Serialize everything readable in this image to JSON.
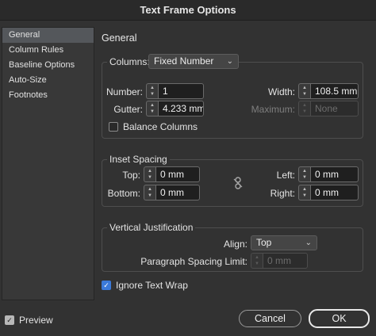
{
  "window": {
    "title": "Text Frame Options"
  },
  "sidebar": {
    "items": [
      {
        "label": "General",
        "active": true
      },
      {
        "label": "Column Rules"
      },
      {
        "label": "Baseline Options"
      },
      {
        "label": "Auto-Size"
      },
      {
        "label": "Footnotes"
      }
    ]
  },
  "general": {
    "heading": "General",
    "columns": {
      "label": "Columns:",
      "type_selected": "Fixed Number",
      "number_label": "Number:",
      "number_value": "1",
      "gutter_label": "Gutter:",
      "gutter_value": "4.233 mm",
      "width_label": "Width:",
      "width_value": "108.5 mm",
      "maximum_label": "Maximum:",
      "maximum_value": "None",
      "balance_label": "Balance Columns",
      "balance_checked": false
    },
    "inset": {
      "legend": "Inset Spacing",
      "top_label": "Top:",
      "top_value": "0 mm",
      "bottom_label": "Bottom:",
      "bottom_value": "0 mm",
      "left_label": "Left:",
      "left_value": "0 mm",
      "right_label": "Right:",
      "right_value": "0 mm"
    },
    "vertical": {
      "legend": "Vertical Justification",
      "align_label": "Align:",
      "align_selected": "Top",
      "para_label": "Paragraph Spacing Limit:",
      "para_value": "0 mm"
    },
    "ignore_wrap": {
      "label": "Ignore Text Wrap",
      "checked": true
    }
  },
  "footer": {
    "preview_label": "Preview",
    "preview_checked": true,
    "cancel_label": "Cancel",
    "ok_label": "OK"
  },
  "colors": {
    "accent": "#3b7ad9",
    "background": "#323232",
    "field": "#1f1f1f"
  }
}
